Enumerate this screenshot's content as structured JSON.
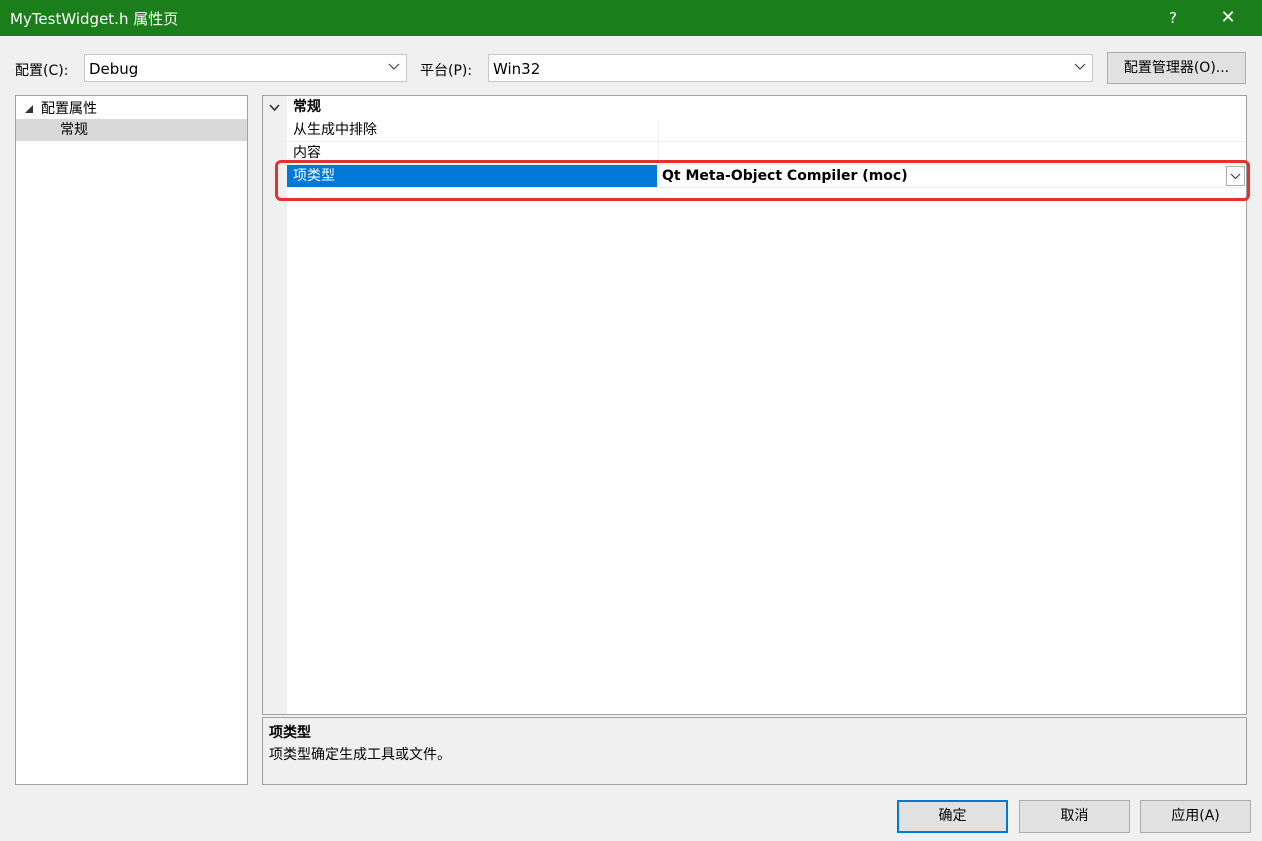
{
  "window": {
    "title": "MyTestWidget.h 属性页",
    "help": "?",
    "close": "✕"
  },
  "toolbar": {
    "config_label": "配置(C):",
    "config_value": "Debug",
    "platform_label": "平台(P):",
    "platform_value": "Win32",
    "config_manager_label": "配置管理器(O)..."
  },
  "tree": {
    "root_label": "配置属性",
    "child_label": "常规"
  },
  "grid": {
    "category": "常规",
    "rows": [
      {
        "name": "从生成中排除",
        "value": ""
      },
      {
        "name": "内容",
        "value": ""
      },
      {
        "name": "项类型",
        "value": "Qt Meta-Object Compiler (moc)"
      }
    ]
  },
  "description": {
    "title": "项类型",
    "text": "项类型确定生成工具或文件。"
  },
  "buttons": {
    "ok": "确定",
    "cancel": "取消",
    "apply": "应用(A)"
  },
  "colors": {
    "titlebar": "#1a7f1a",
    "selection": "#0078d7",
    "highlight": "#e53030"
  }
}
